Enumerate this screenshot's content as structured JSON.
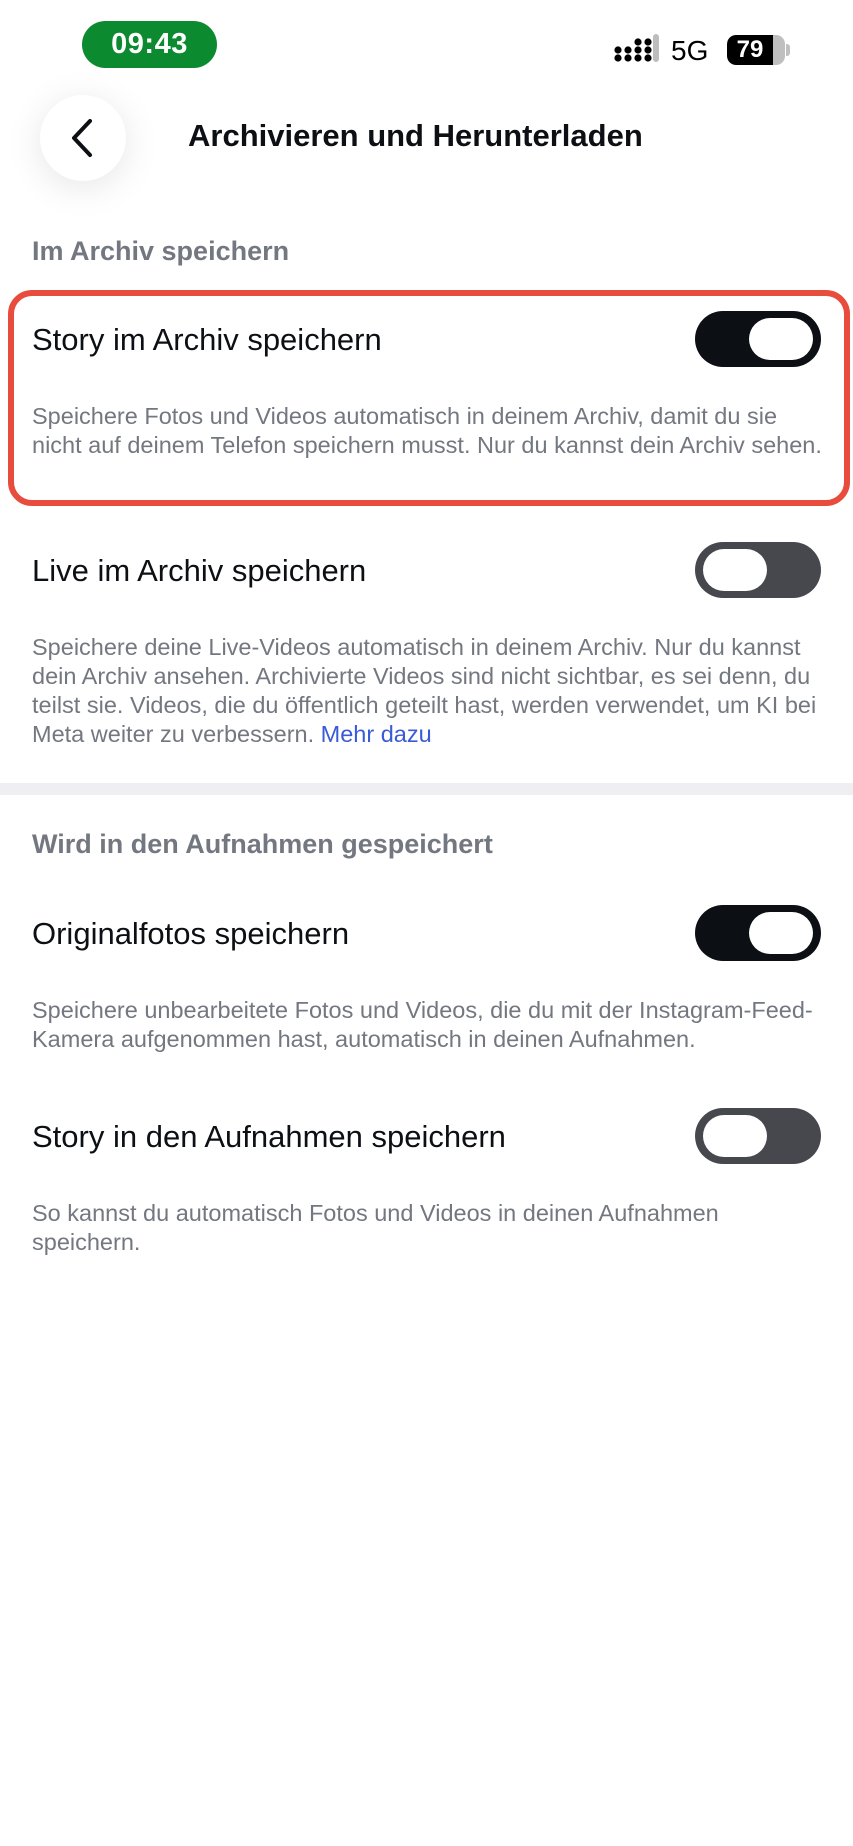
{
  "status_bar": {
    "time": "09:43",
    "network": "5G",
    "battery": "79",
    "battery_fraction": 0.79,
    "time_pill_color": "#0b8a2f"
  },
  "header": {
    "back_icon": "chevron-left-icon",
    "title": "Archivieren und Herunterladen"
  },
  "archive_section": {
    "title": "Im Archiv speichern",
    "rows": [
      {
        "label": "Story im Archiv speichern",
        "enabled": true,
        "description": "Speichere Fotos und Videos automatisch in deinem Archiv, damit du sie nicht auf deinem Telefon speichern musst. Nur du kannst dein Archiv sehen."
      },
      {
        "label": "Live im Archiv speichern",
        "enabled": false,
        "description": "Speichere deine Live-Videos automatisch in deinem Archiv. Nur du kannst dein Archiv ansehen. Archivierte Videos sind nicht sichtbar, es sei denn, du teilst sie. Videos, die du öffentlich geteilt hast, werden verwendet, um KI bei Meta weiter zu verbessern.",
        "link": "Mehr dazu"
      }
    ]
  },
  "recordings_section": {
    "title": "Wird in den Aufnahmen gespeichert",
    "rows": [
      {
        "label": "Originalfotos speichern",
        "enabled": true,
        "description": "Speichere unbearbeitete Fotos und Videos, die du mit der Instagram-Feed-Kamera aufgenommen hast, automatisch in deinen Aufnahmen."
      },
      {
        "label": "Story in den Aufnahmen speichern",
        "enabled": false,
        "description": "So kannst du automatisch Fotos und Videos in deinen Aufnahmen speichern."
      }
    ]
  },
  "colors": {
    "highlight_border": "#e74c3c",
    "link": "#3a5bd6",
    "toggle_on": "#0c1014",
    "toggle_off": "#46484e"
  }
}
